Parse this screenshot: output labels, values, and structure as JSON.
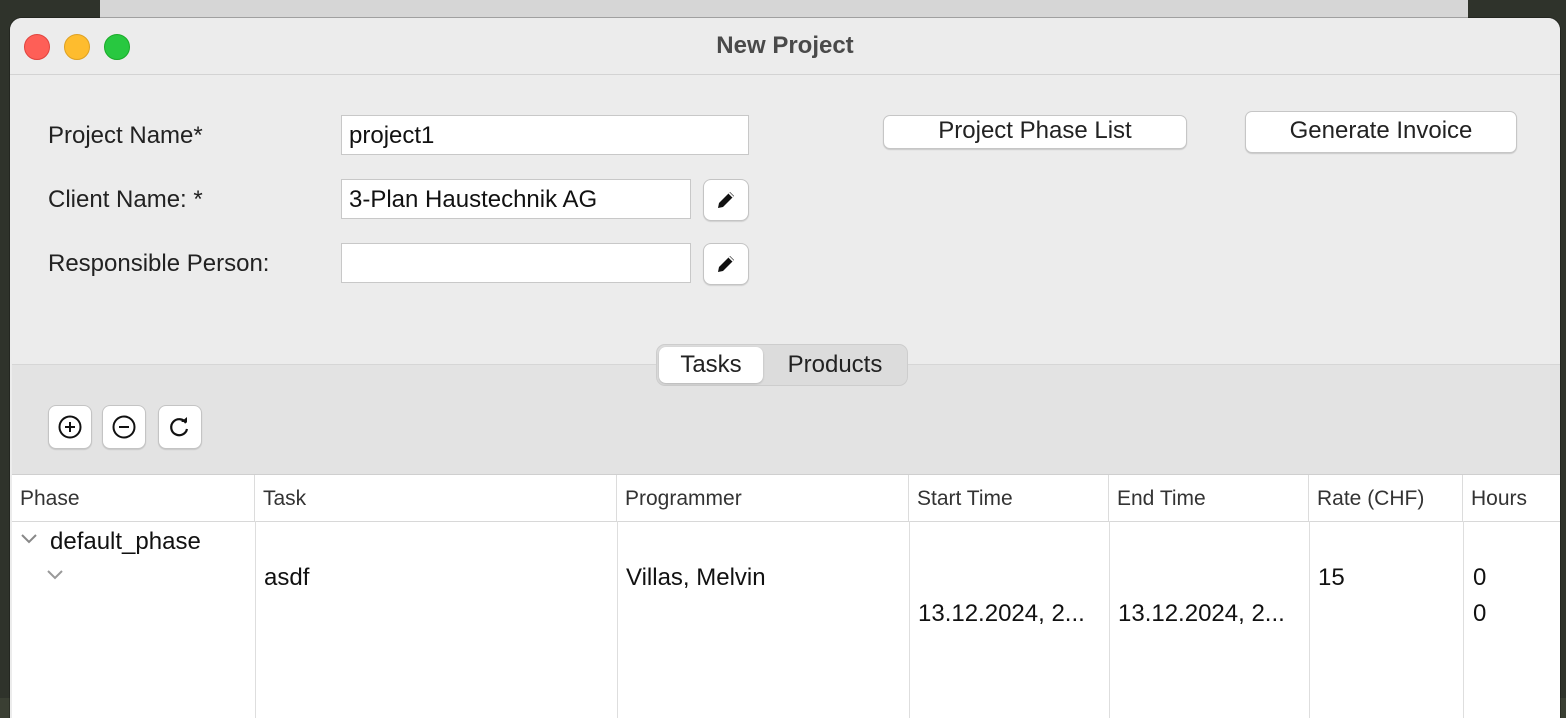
{
  "window": {
    "title": "New Project"
  },
  "form": {
    "project_name_label": "Project Name*",
    "project_name_value": "project1",
    "client_name_label": "Client Name: *",
    "client_name_value": "3-Plan Haustechnik AG",
    "responsible_person_label": "Responsible Person:",
    "responsible_person_value": ""
  },
  "actions": {
    "phase_list_label": "Project Phase List",
    "generate_invoice_label": "Generate Invoice"
  },
  "tabs": [
    {
      "label": "Tasks",
      "selected": true
    },
    {
      "label": "Products",
      "selected": false
    }
  ],
  "toolbar": {
    "icons": [
      "add-circle-icon",
      "remove-circle-icon",
      "refresh-icon"
    ]
  },
  "table": {
    "columns": [
      "Phase",
      "Task",
      "Programmer",
      "Start Time",
      "End Time",
      "Rate (CHF)",
      "Hours"
    ],
    "phase_row": {
      "phase": "default_phase"
    },
    "task_row": {
      "task": "asdf",
      "programmer": "Villas, Melvin",
      "start_time": "13.12.2024, 2...",
      "end_time": "13.12.2024, 2...",
      "rate": "15",
      "hours": "0",
      "hours_sub": "0"
    }
  }
}
